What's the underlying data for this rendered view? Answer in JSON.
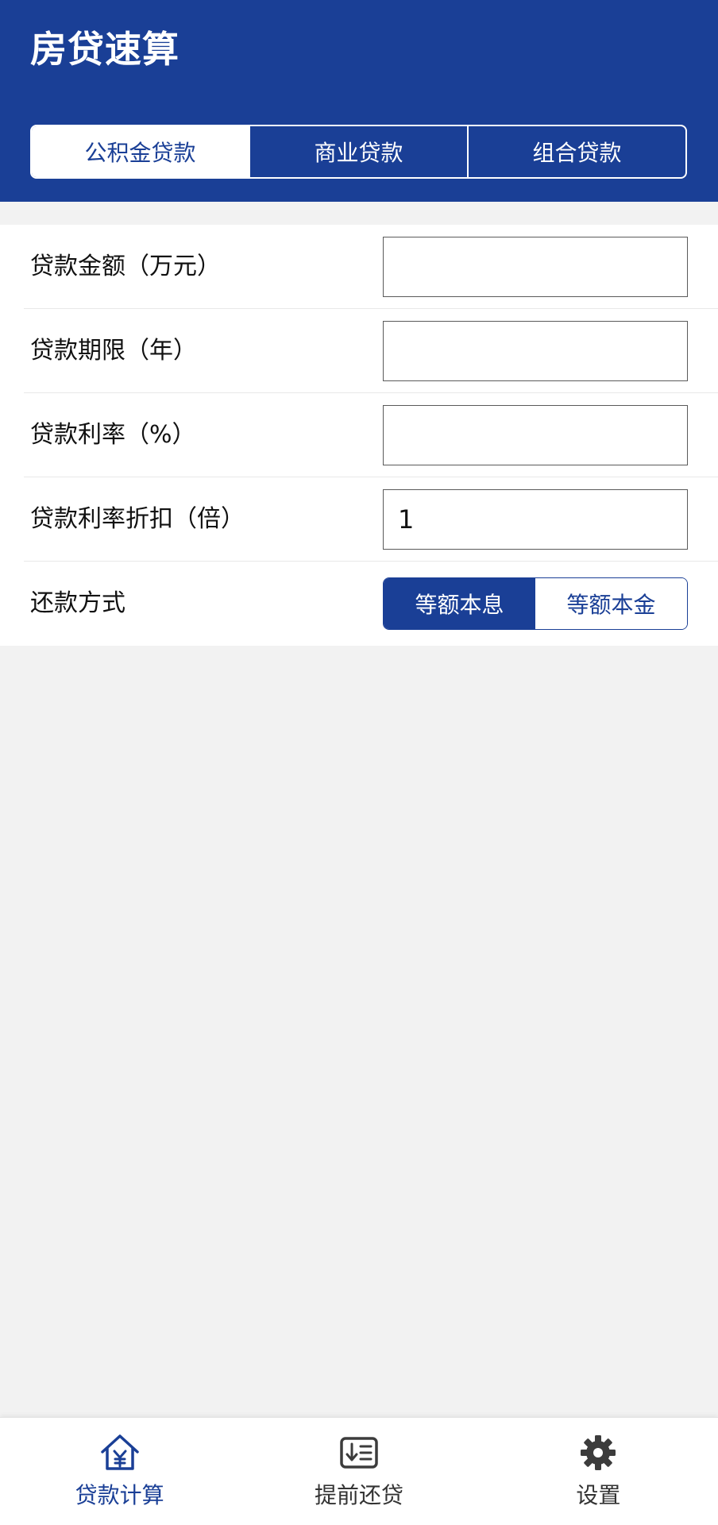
{
  "app": {
    "title": "房贷速算"
  },
  "loan_tabs": [
    {
      "label": "公积金贷款",
      "active": true
    },
    {
      "label": "商业贷款",
      "active": false
    },
    {
      "label": "组合贷款",
      "active": false
    }
  ],
  "form": {
    "amount": {
      "label": "贷款金额（万元）",
      "value": ""
    },
    "term": {
      "label": "贷款期限（年）",
      "value": ""
    },
    "rate": {
      "label": "贷款利率（%）",
      "value": ""
    },
    "discount": {
      "label": "贷款利率折扣（倍）",
      "value": "1"
    },
    "method": {
      "label": "还款方式",
      "options": [
        {
          "label": "等额本息",
          "active": true
        },
        {
          "label": "等额本金",
          "active": false
        }
      ]
    }
  },
  "bottom_nav": [
    {
      "label": "贷款计算",
      "icon": "house-yen-icon",
      "active": true
    },
    {
      "label": "提前还贷",
      "icon": "prepay-icon",
      "active": false
    },
    {
      "label": "设置",
      "icon": "gear-icon",
      "active": false
    }
  ],
  "colors": {
    "primary": "#1a3f96",
    "background": "#f2f2f2",
    "surface": "#ffffff",
    "text": "#111111",
    "icon_gray": "#3c3c3c"
  }
}
